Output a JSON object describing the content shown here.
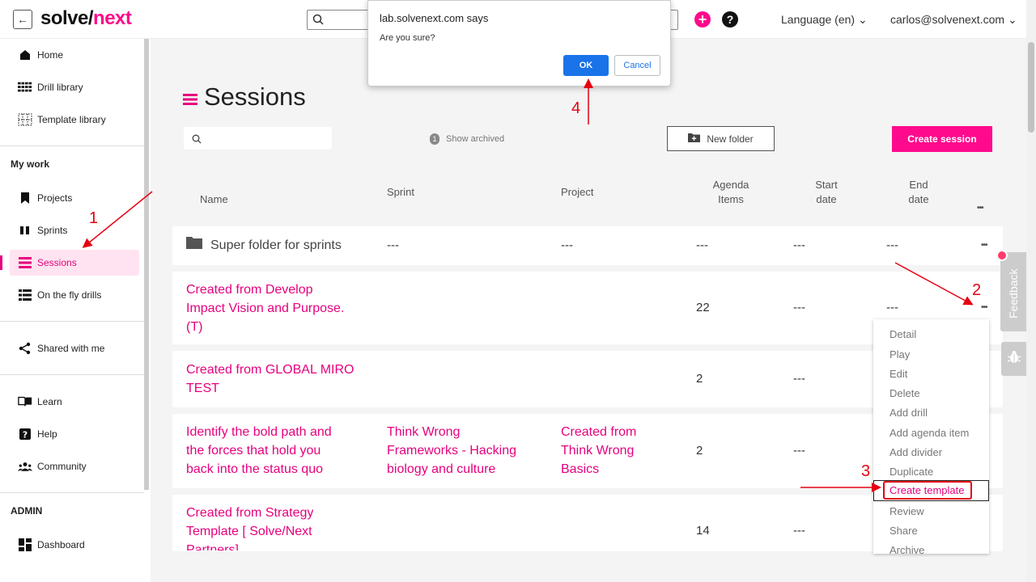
{
  "header": {
    "back_icon": "arrow-left-icon",
    "logo_part1": "solve/",
    "logo_part2": "next",
    "language": "Language (en)",
    "user_email": "carlos@solvenext.com",
    "accent_color": "#ff0a8c"
  },
  "sidebar": {
    "items": [
      {
        "label": "Home",
        "icon": "home-icon"
      },
      {
        "label": "Drill library",
        "icon": "grid-icon"
      },
      {
        "label": "Template library",
        "icon": "dotted-grid-icon"
      },
      {
        "label": "Projects",
        "icon": "bookmark-icon"
      },
      {
        "label": "Sprints",
        "icon": "columns-icon"
      },
      {
        "label": "Sessions",
        "icon": "list-icon"
      },
      {
        "label": "On the fly drills",
        "icon": "list-detail-icon"
      },
      {
        "label": "Shared with me",
        "icon": "share-icon"
      },
      {
        "label": "Learn",
        "icon": "book-icon"
      },
      {
        "label": "Help",
        "icon": "question-icon"
      },
      {
        "label": "Community",
        "icon": "people-icon"
      },
      {
        "label": "Dashboard",
        "icon": "dashboard-icon"
      }
    ],
    "my_work_label": "My work",
    "admin_label": "ADMIN"
  },
  "main": {
    "title": "Sessions",
    "show_archived_label": "Show archived",
    "show_archived_count": "1",
    "new_folder_label": "New folder",
    "create_session_label": "Create session",
    "columns": {
      "name": "Name",
      "sprint": "Sprint",
      "project": "Project",
      "agenda_1": "Agenda",
      "agenda_2": "Items",
      "start_1": "Start",
      "start_2": "date",
      "end_1": "End",
      "end_2": "date"
    },
    "rows": [
      {
        "name": "Super folder for sprints",
        "sprint": "---",
        "project": "---",
        "agenda": "---",
        "start": "---",
        "end": "---"
      },
      {
        "name_lines": [
          "Created from Develop",
          "Impact Vision and Purpose.",
          "(T)"
        ],
        "agenda": "22",
        "start": "---",
        "end": "---"
      },
      {
        "name_lines": [
          "Created from GLOBAL MIRO",
          "TEST"
        ],
        "agenda": "2",
        "start": "---"
      },
      {
        "name_lines": [
          "Identify the bold path and",
          "the forces that hold you",
          "back into the status quo"
        ],
        "sprint_lines": [
          "Think Wrong",
          "Frameworks - Hacking",
          "biology and culture"
        ],
        "project_lines": [
          "Created from",
          "Think Wrong",
          "Basics"
        ],
        "agenda": "2",
        "start": "---"
      },
      {
        "name_lines": [
          "Created from Strategy",
          "Template [ Solve/Next",
          "Partners]"
        ],
        "agenda": "14",
        "start": "---"
      }
    ]
  },
  "context_menu": {
    "items": [
      "Detail",
      "Play",
      "Edit",
      "Delete",
      "Add drill",
      "Add agenda item",
      "Add divider",
      "Duplicate",
      "Create template",
      "Review",
      "Share",
      "Archive"
    ]
  },
  "feedback_label": "Feedback",
  "dialog": {
    "title": "lab.solvenext.com says",
    "message": "Are you sure?",
    "ok_label": "OK",
    "cancel_label": "Cancel"
  },
  "annotations": [
    "1",
    "2",
    "3",
    "4"
  ],
  "annotation_color": "#e60012"
}
